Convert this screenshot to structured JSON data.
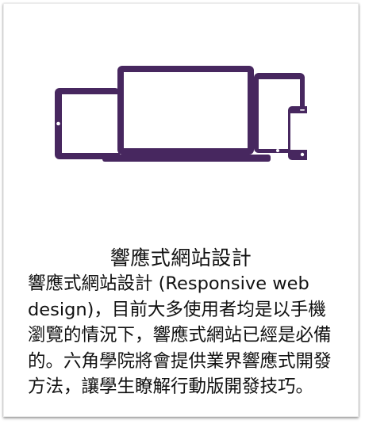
{
  "card": {
    "title": "響應式網站設計",
    "body": "響應式網站設計 (Responsive web design)，目前大多使用者均是以手機瀏覽的情況下，響應式網站已經是必備的。六角學院將會提供業界響應式開發方法，讓學生瞭解行動版開發技巧。"
  },
  "colors": {
    "device_purple": "#47275f",
    "card_background": "#ffffff",
    "text": "#111111"
  },
  "icons": [
    "tablet-icon",
    "laptop-icon",
    "tablet-small-icon",
    "phone-icon"
  ]
}
